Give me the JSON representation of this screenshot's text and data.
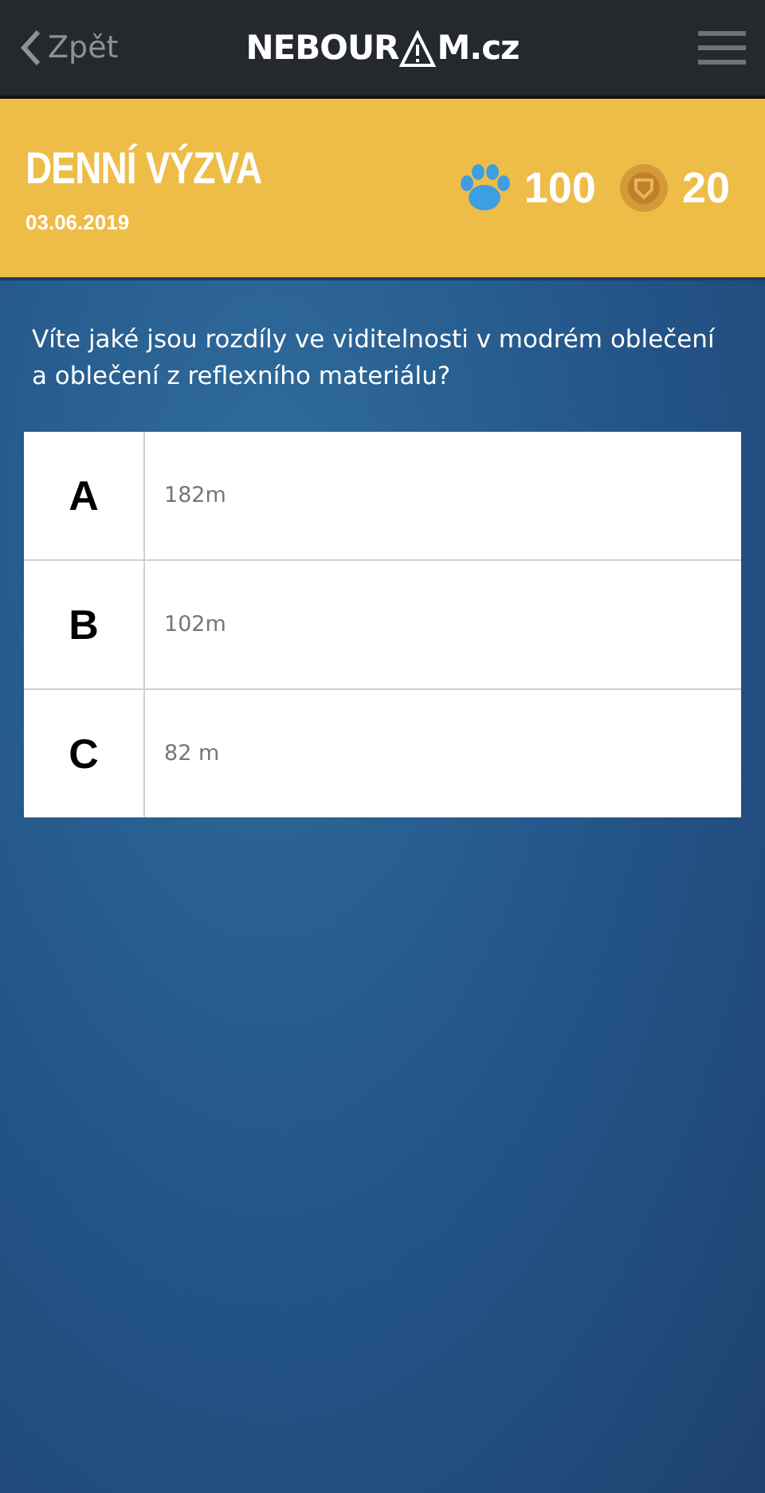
{
  "nav": {
    "back": "Zpět",
    "logo_before": "NEBOUR",
    "logo_after": "M.cz"
  },
  "challenge": {
    "title": "DENNÍ VÝZVA",
    "date": "03.06.2019",
    "paws": "100",
    "coins": "20"
  },
  "question": "Víte jaké jsou rozdíly ve viditelnosti v modrém oblečení a oblečení z reflexního materiálu?",
  "answers": [
    {
      "letter": "A",
      "text": "182m"
    },
    {
      "letter": "B",
      "text": "102m"
    },
    {
      "letter": "C",
      "text": "82 m"
    }
  ]
}
